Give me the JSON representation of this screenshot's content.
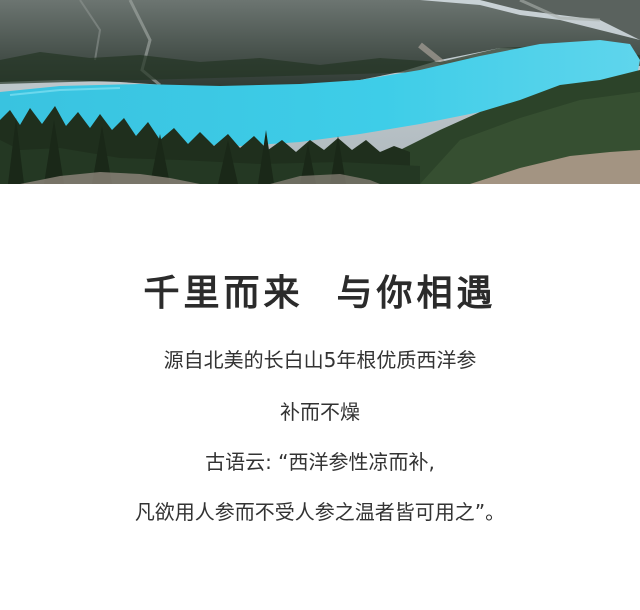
{
  "hero_image": {
    "alt_icon": "mountain-lake-landscape",
    "colors": {
      "sky": "#b9c4cc",
      "mountain": "#4b5350",
      "forest": "#253924",
      "lake": "#38c8e6",
      "ground": "#9b8f85"
    }
  },
  "content": {
    "title": "千里而来  与你相遇",
    "lines": [
      "源自北美的长白山5年根优质西洋参",
      "补而不燥",
      "古语云: “西洋参性凉而补,",
      "凡欲用人参而不受人参之温者皆可用之”。"
    ]
  }
}
